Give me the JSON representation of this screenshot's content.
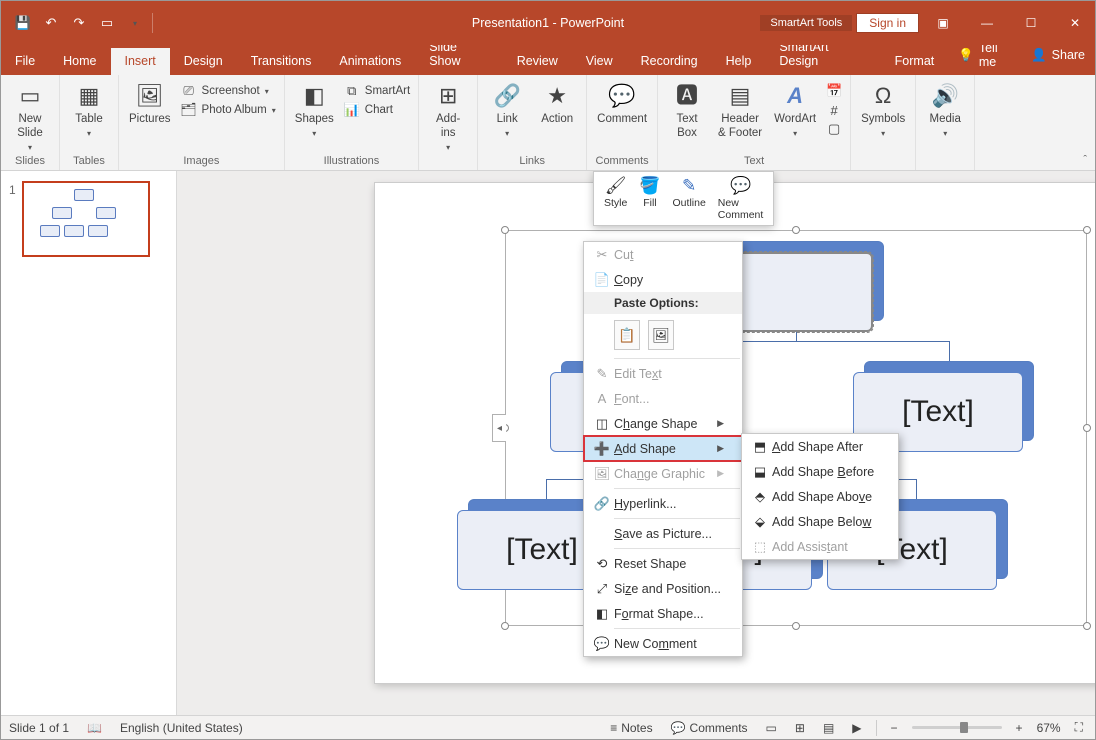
{
  "title": "Presentation1 - PowerPoint",
  "context_tools": "SmartArt Tools",
  "signin": "Sign in",
  "tabs": {
    "file": "File",
    "home": "Home",
    "insert": "Insert",
    "design": "Design",
    "transitions": "Transitions",
    "animations": "Animations",
    "slideshow": "Slide Show",
    "review": "Review",
    "view": "View",
    "recording": "Recording",
    "help": "Help",
    "smartart_design": "SmartArt Design",
    "format": "Format",
    "tellme": "Tell me",
    "share": "Share"
  },
  "ribbon": {
    "slides": {
      "label": "Slides",
      "new_slide": "New\nSlide"
    },
    "tables": {
      "label": "Tables",
      "table": "Table"
    },
    "images": {
      "label": "Images",
      "pictures": "Pictures",
      "screenshot": "Screenshot",
      "photo_album": "Photo Album"
    },
    "illustrations": {
      "label": "Illustrations",
      "shapes": "Shapes",
      "smartart": "SmartArt",
      "chart": "Chart"
    },
    "addins": {
      "label": "",
      "addins": "Add-\nins"
    },
    "links": {
      "label": "Links",
      "link": "Link",
      "action": "Action"
    },
    "comments": {
      "label": "Comments",
      "comment": "Comment"
    },
    "text": {
      "label": "Text",
      "text_box": "Text\nBox",
      "header_footer": "Header\n& Footer",
      "wordart": "WordArt"
    },
    "symbols": {
      "label": "",
      "symbols": "Symbols"
    },
    "media": {
      "label": "",
      "media": "Media"
    }
  },
  "thumb": {
    "num": "1"
  },
  "smartart_text": "[Text]",
  "mini_toolbar": {
    "style": "Style",
    "fill": "Fill",
    "outline": "Outline",
    "new_comment": "New\nComment"
  },
  "context_menu": {
    "cut": "Cut",
    "copy": "Copy",
    "paste_options": "Paste Options:",
    "edit_text": "Edit Text",
    "font": "Font...",
    "change_shape": "Change Shape",
    "add_shape": "Add Shape",
    "change_graphic": "Change Graphic",
    "hyperlink": "Hyperlink...",
    "save_as_picture": "Save as Picture...",
    "reset_shape": "Reset Shape",
    "size_position": "Size and Position...",
    "format_shape": "Format Shape...",
    "new_comment": "New Comment"
  },
  "submenu": {
    "after": "Add Shape After",
    "before": "Add Shape Before",
    "above": "Add Shape Above",
    "below": "Add Shape Below",
    "assistant": "Add Assistant"
  },
  "statusbar": {
    "slide": "Slide 1 of 1",
    "lang": "English (United States)",
    "notes": "Notes",
    "comments": "Comments",
    "zoom": "67%"
  }
}
